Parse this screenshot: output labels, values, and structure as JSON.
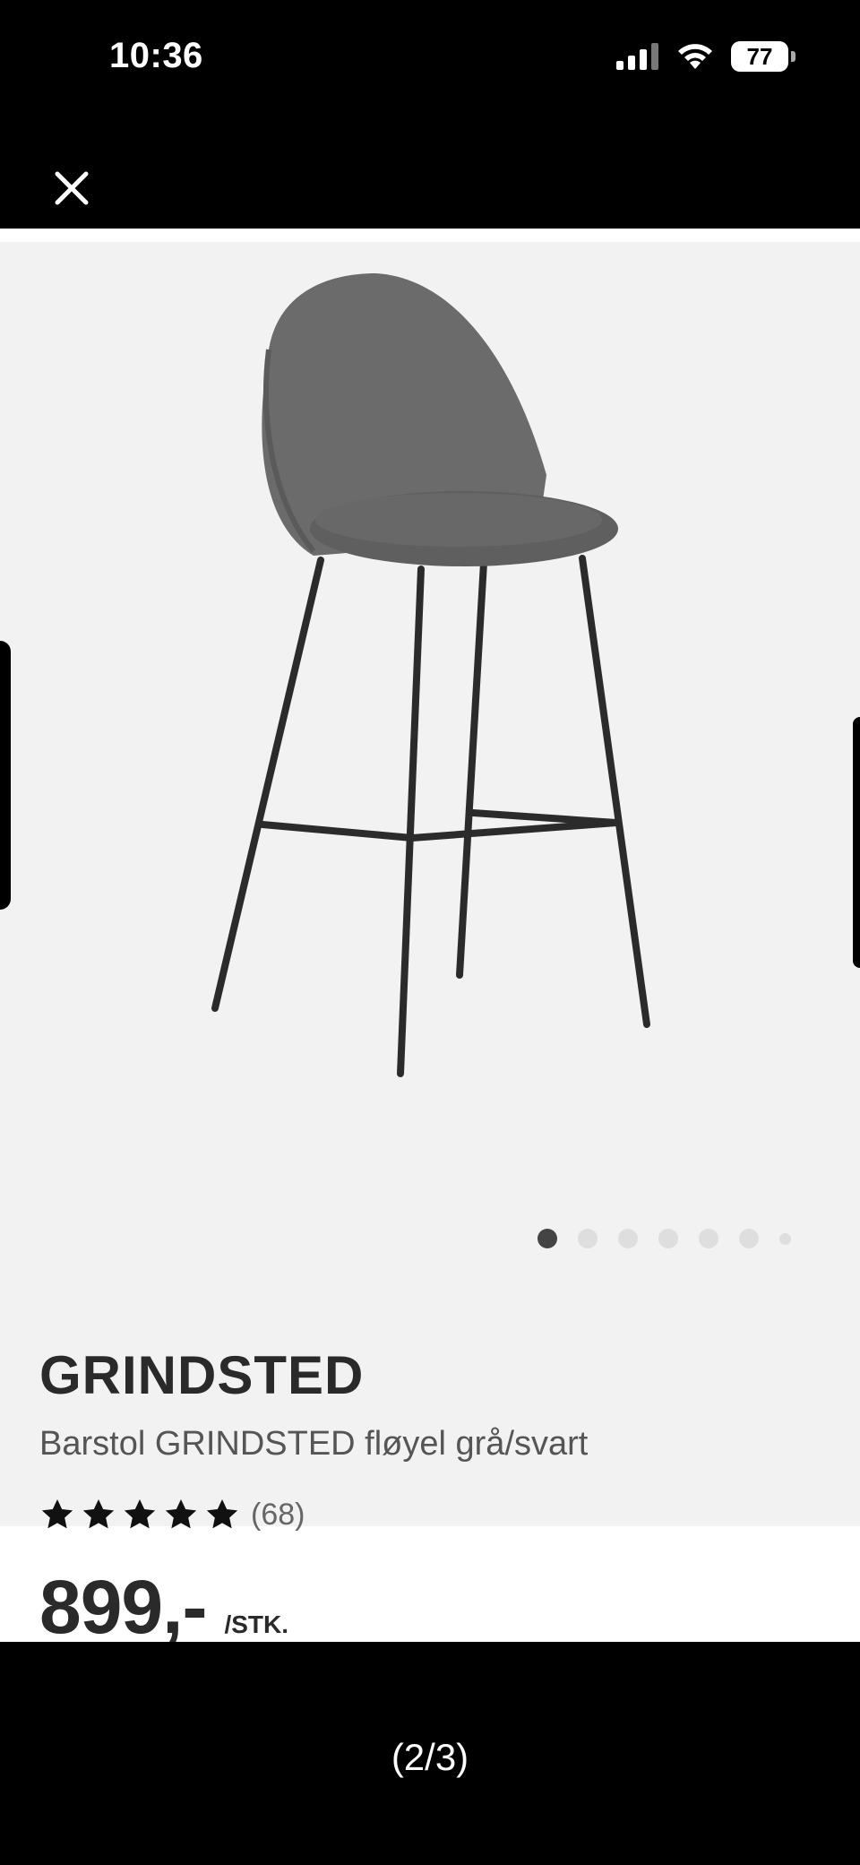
{
  "status_bar": {
    "time": "10:36",
    "battery": "77"
  },
  "viewer": {
    "pager": "(2/3)"
  },
  "carousel": {
    "dots": 7,
    "active_index": 0
  },
  "product": {
    "brand": "GRINDSTED",
    "description": "Barstol GRINDSTED fløyel grå/svart",
    "rating_count": "(68)",
    "rating_stars": 5,
    "price": "899,-",
    "unit": "/STK."
  },
  "colors": {
    "background": "#000000",
    "photo_bg": "#f2f2f2",
    "text_dark": "#2a2a2a",
    "dot_active": "#444444",
    "dot_inactive": "#dedede"
  }
}
